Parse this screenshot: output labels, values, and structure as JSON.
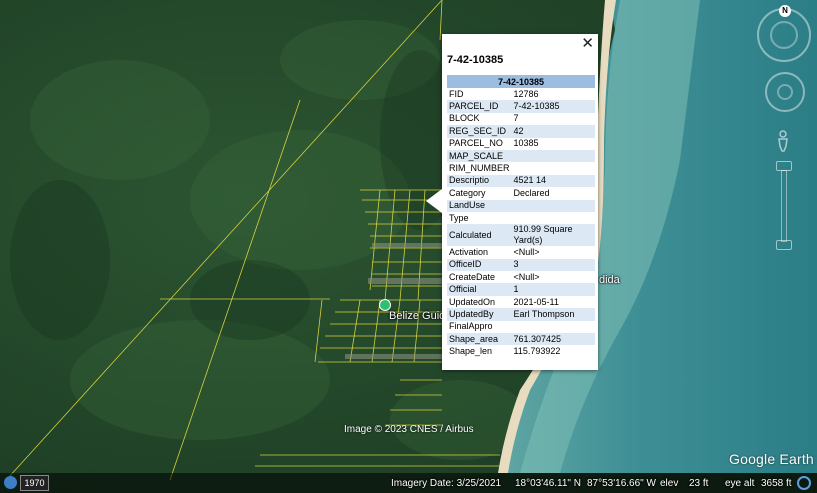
{
  "popup": {
    "title": "7-42-10385",
    "header": "7-42-10385",
    "close_icon": "close-icon",
    "rows": [
      {
        "key": "FID",
        "value": "12786"
      },
      {
        "key": "PARCEL_ID",
        "value": "7-42-10385"
      },
      {
        "key": "BLOCK",
        "value": "7"
      },
      {
        "key": "REG_SEC_ID",
        "value": "42"
      },
      {
        "key": "PARCEL_NO",
        "value": "10385"
      },
      {
        "key": "MAP_SCALE",
        "value": ""
      },
      {
        "key": "RIM_NUMBER",
        "value": ""
      },
      {
        "key": "Descriptio",
        "value": "4521 14"
      },
      {
        "key": "Category",
        "value": "Declared"
      },
      {
        "key": "LandUse",
        "value": ""
      },
      {
        "key": "Type",
        "value": ""
      },
      {
        "key": "Calculated",
        "value": "910.99 Square Yard(s)"
      },
      {
        "key": "Activation",
        "value": "<Null>"
      },
      {
        "key": "OfficeID",
        "value": "3"
      },
      {
        "key": "CreateDate",
        "value": "<Null>"
      },
      {
        "key": "Official",
        "value": "1"
      },
      {
        "key": "UpdatedOn",
        "value": "2021-05-11"
      },
      {
        "key": "UpdatedBy",
        "value": "Earl Thompson"
      },
      {
        "key": "FinalAppro",
        "value": ""
      },
      {
        "key": "Shape_area",
        "value": "761.307425"
      },
      {
        "key": "Shape_len",
        "value": "115.793922"
      }
    ]
  },
  "map": {
    "place_label": "Belize Guid",
    "place_label_2": "dida",
    "copyright": "Image © 2023 CNES / Airbus",
    "logo": "Google Earth",
    "compass_letter": "N"
  },
  "status": {
    "year": "1970",
    "imagery_date": "Imagery Date: 3/25/2021",
    "lat": "18°03'46.11\" N",
    "lon": "87°53'16.66\" W",
    "elev_label": "elev",
    "elev_value": "23 ft",
    "eye_label": "eye alt",
    "eye_value": "3658 ft"
  },
  "colors": {
    "parcel_lines": "#e8e040",
    "popup_header": "#9cbde0",
    "popup_alt_row": "#dce8f4"
  }
}
